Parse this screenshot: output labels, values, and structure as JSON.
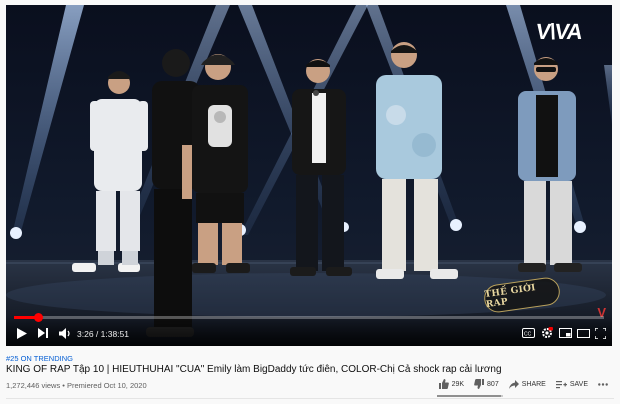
{
  "player": {
    "brand_logo": "V\\VA",
    "watermark": "V",
    "show_badge": "THẾ GIỚI RAP",
    "progress_fraction": 0.04,
    "time_display": "3:26 / 1:38:51"
  },
  "video": {
    "hashtag": "#25 ON TRENDING",
    "title": "KING OF RAP Tập 10 | HIEUTHUHAI \"CUA\" Emily làm BigDaddy tức điên, COLOR-Chị Cả shock rap cải lương",
    "views": "1,272,446 views",
    "premiered": "Premiered Oct 10, 2020"
  },
  "actions": {
    "likes": "29K",
    "dislikes": "807",
    "share_label": "SHARE",
    "save_label": "SAVE",
    "like_fraction": 0.97
  },
  "icons": {
    "play": "play-icon",
    "next": "next-icon",
    "volume": "volume-icon",
    "captions": "captions-icon",
    "settings": "gear-icon",
    "miniplayer": "miniplayer-icon",
    "theater": "theater-icon",
    "fullscreen": "fullscreen-icon",
    "like": "thumbs-up-icon",
    "dislike": "thumbs-down-icon",
    "share": "share-icon",
    "save": "save-icon",
    "more": "more-icon"
  },
  "colors": {
    "progress": "#ff0000",
    "link": "#065fd4",
    "title": "#0f0f0f",
    "meta": "#606060"
  }
}
